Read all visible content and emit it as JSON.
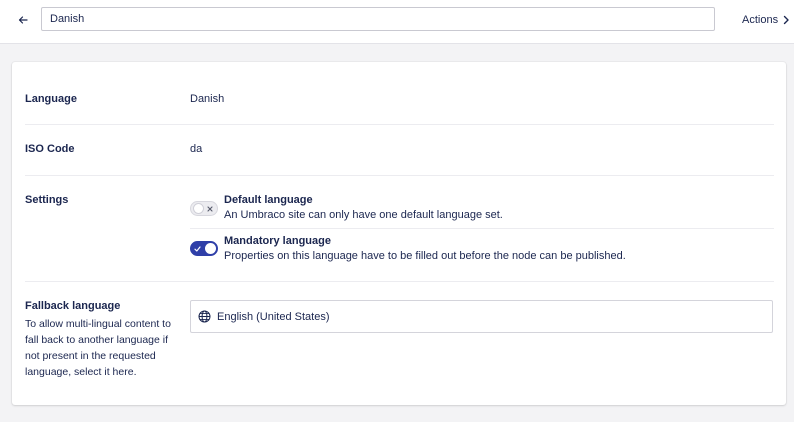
{
  "header": {
    "name_value": "Danish",
    "actions_label": "Actions"
  },
  "fields": {
    "language": {
      "label": "Language",
      "value": "Danish"
    },
    "iso_code": {
      "label": "ISO Code",
      "value": "da"
    },
    "settings": {
      "label": "Settings",
      "default_language": {
        "title": "Default language",
        "description": "An Umbraco site can only have one default language set.",
        "enabled": false
      },
      "mandatory_language": {
        "title": "Mandatory language",
        "description": "Properties on this language have to be filled out before the node can be published.",
        "enabled": true
      }
    },
    "fallback": {
      "label": "Fallback language",
      "description": "To allow multi-lingual content to fall back to another language if not present in the requested language, select it here.",
      "selected": "English (United States)"
    }
  },
  "icons": {
    "back": "arrow-left-icon",
    "actions": "chevron-right-icon",
    "toggle_off": "x-icon",
    "toggle_on": "check-icon",
    "fallback": "globe-icon"
  },
  "colors": {
    "text": "#1b264f",
    "accent": "#2f3fa8",
    "background": "#f3f3f5"
  }
}
